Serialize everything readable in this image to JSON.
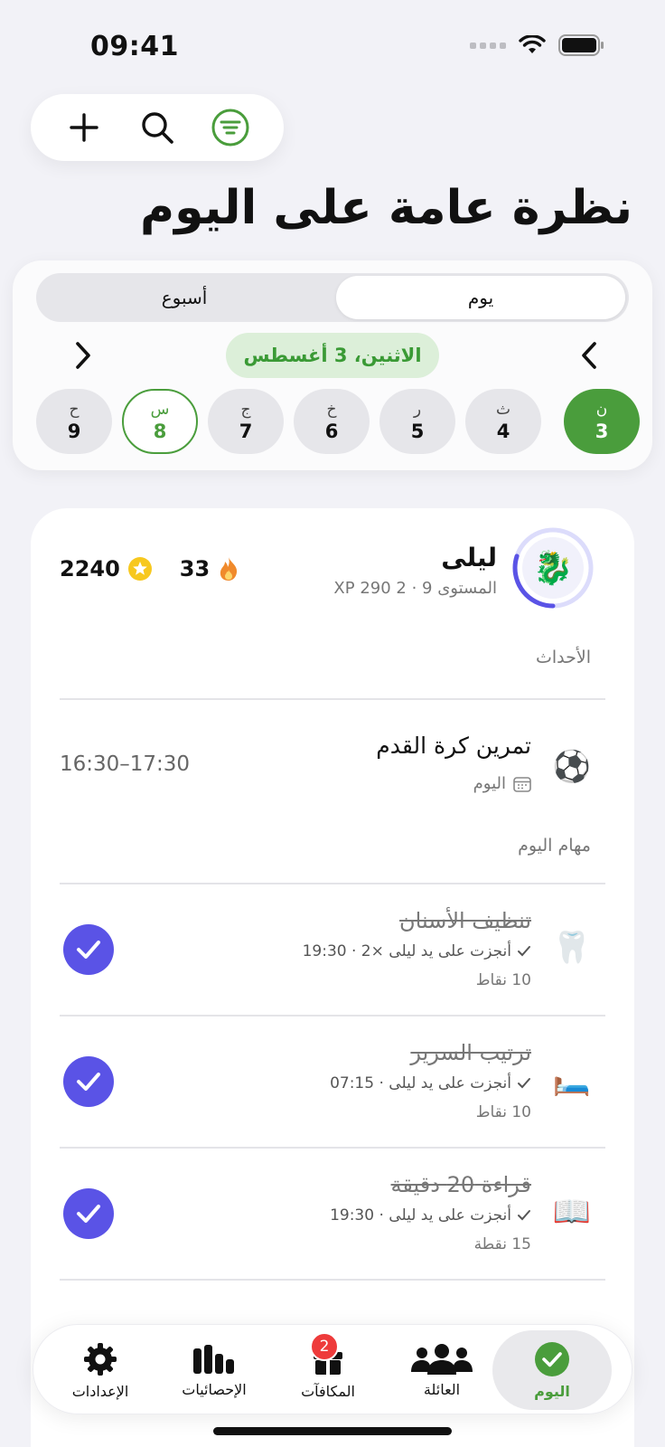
{
  "status_bar": {
    "time": "09:41"
  },
  "page": {
    "title": "نظرة عامة على اليوم"
  },
  "view_switch": {
    "week": "أسبوع",
    "day": "يوم"
  },
  "date_nav": {
    "current": "الاثنين، 3 أغسطس"
  },
  "days": [
    {
      "letter": "ن",
      "num": "3"
    },
    {
      "letter": "ث",
      "num": "4"
    },
    {
      "letter": "ر",
      "num": "5"
    },
    {
      "letter": "خ",
      "num": "6"
    },
    {
      "letter": "ج",
      "num": "7"
    },
    {
      "letter": "س",
      "num": "8"
    },
    {
      "letter": "ح",
      "num": "9"
    }
  ],
  "profile": {
    "name": "ليلى",
    "level": "المستوى 9 · 2 290 XP",
    "streak": "33",
    "stars": "2240",
    "level_progress": 0.3
  },
  "events": {
    "label": "الأحداث",
    "items": [
      {
        "emoji": "⚽",
        "title": "تمرين كرة القدم",
        "sub": "اليوم",
        "time": "16:30–17:30"
      }
    ]
  },
  "tasks": {
    "label": "مهام اليوم",
    "items": [
      {
        "emoji": "🦷",
        "title": "تنظيف الأسنان",
        "done": "أنجزت على يد ليلى ×2 · 19:30",
        "points": "10 نقاط"
      },
      {
        "emoji": "🛏️",
        "title": "ترتيب السرير",
        "done": "أنجزت على يد ليلى · 07:15",
        "points": "10 نقاط"
      },
      {
        "emoji": "📖",
        "title": "قراءة 20 دقيقة",
        "done": "أنجزت على يد ليلى · 19:30",
        "points": "15 نقطة"
      }
    ]
  },
  "tabbar": {
    "today": "اليوم",
    "family": "العائلة",
    "rewards": "المكافآت",
    "rewards_badge": "2",
    "stats": "الإحصائيات",
    "settings": "الإعدادات"
  },
  "colors": {
    "accent_green": "#4a9d3c",
    "check_purple": "#5a53e6",
    "badge_red": "#ee3b3b"
  }
}
